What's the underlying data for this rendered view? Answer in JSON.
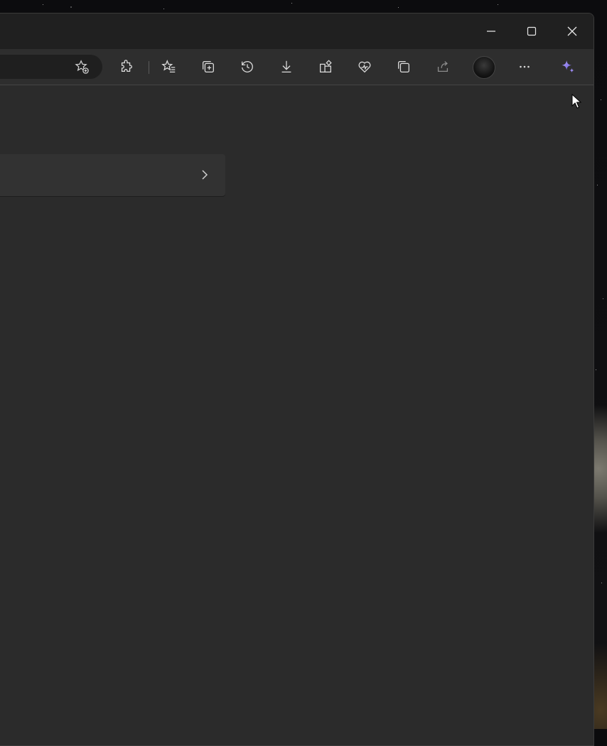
{
  "window": {
    "controls": {
      "minimize_icon": "minimize-icon",
      "maximize_icon": "maximize-icon",
      "close_icon": "close-icon"
    }
  },
  "toolbar": {
    "buttons": [
      {
        "name": "add-favorite-button",
        "icon": "star-plus-icon"
      },
      {
        "name": "extensions-button",
        "icon": "puzzle-icon"
      },
      {
        "name": "favorites-button",
        "icon": "star-list-icon"
      },
      {
        "name": "collections-button",
        "icon": "collections-icon"
      },
      {
        "name": "history-button",
        "icon": "history-icon"
      },
      {
        "name": "downloads-button",
        "icon": "download-icon"
      },
      {
        "name": "apps-button",
        "icon": "apps-icon"
      },
      {
        "name": "browser-essentials-button",
        "icon": "heart-pulse-icon"
      },
      {
        "name": "screenshot-button",
        "icon": "screenshot-icon"
      },
      {
        "name": "share-button",
        "icon": "share-icon"
      },
      {
        "name": "profile-button",
        "icon": "avatar"
      },
      {
        "name": "settings-more-button",
        "icon": "more-icon"
      },
      {
        "name": "copilot-button",
        "icon": "copilot-sparkle-icon"
      }
    ]
  },
  "colors": {
    "titlebar": "#202020",
    "toolbar": "#2e2e2e",
    "content": "#2b2b2b",
    "card": "#323232",
    "copilot_accent": "#8a7cf0"
  }
}
